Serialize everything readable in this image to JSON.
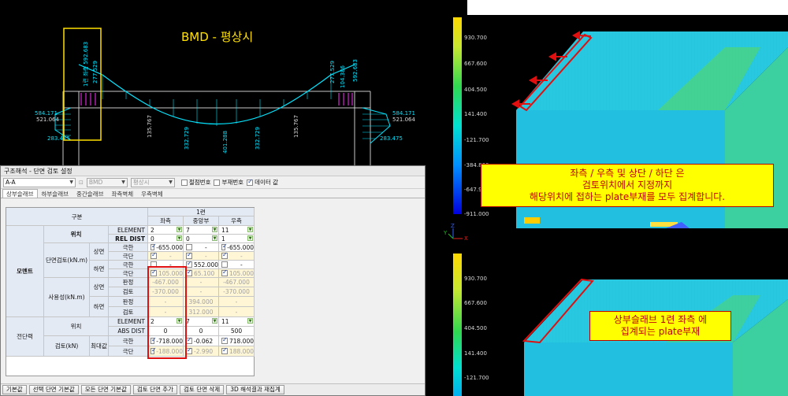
{
  "bmd": {
    "title": "BMD - 평상시",
    "labels": {
      "left_top": "1련 좌측 592.683",
      "left_top2": "277.529",
      "left_mid1": "584.171",
      "left_mid2": "521.064",
      "left_low": "283.475",
      "mid1": "135.767",
      "mid2": "332.729",
      "mid3": "401.288",
      "mid4": "332.729",
      "mid5": "135.767",
      "right_top": "277.529",
      "right_top2": "104.386",
      "right_top3": "592.683",
      "right_mid1": "584.171",
      "right_mid2": "521.064",
      "right_low": "283.475"
    }
  },
  "dialog": {
    "title": "구조해석 - 단면 검토 설정",
    "section_combo": "A-A",
    "bmd_combo": "BMD",
    "case_combo": "평상시",
    "toggles": [
      {
        "label": "절점번호",
        "checked": false
      },
      {
        "label": "부재번호",
        "checked": false
      },
      {
        "label": "데이터 값",
        "checked": true
      }
    ],
    "tabs": [
      "상부슬래브",
      "하부슬래브",
      "중간슬래브",
      "좌측벽체",
      "우측벽체"
    ],
    "grid": {
      "h_gubun": "구분",
      "h_span": "1련",
      "h_left": "좌측",
      "h_mid": "중앙부",
      "h_right": "우측",
      "g_moment": "모멘트",
      "g_shear": "전단력",
      "pos": "위치",
      "element": "ELEMENT",
      "rel_dist": "REL DIST",
      "abs_dist": "ABS DIST",
      "section_check": "단면검토(kN.m)",
      "service": "사용성(kN.m)",
      "shear_check": "검토(kN)",
      "top": "상면",
      "bottom": "하면",
      "max": "최대값",
      "ext": "극한",
      "min": "극단",
      "judge": "판정",
      "check": "검토",
      "el_left": "2",
      "el_mid": "7",
      "el_right": "11",
      "rd_left": "0",
      "rd_mid": "0",
      "rd_right": "1",
      "m_top_ext_l": "-655.000",
      "m_top_ext_m": "-",
      "m_top_ext_r": "-655.000",
      "m_top_min_l": "-",
      "m_top_min_m": "-",
      "m_top_min_r": "-",
      "m_bot_ext_l": "-",
      "m_bot_ext_m": "552.000",
      "m_bot_ext_r": "-",
      "m_bot_min_l": "105.000",
      "m_bot_min_m": "65.100",
      "m_bot_min_r": "105.000",
      "s_top_j_l": "-467.000",
      "s_top_j_m": "-",
      "s_top_j_r": "-467.000",
      "s_top_c_l": "-370.000",
      "s_top_c_m": "-",
      "s_top_c_r": "-370.000",
      "s_bot_j_l": "-",
      "s_bot_j_m": "394.000",
      "s_bot_j_r": "-",
      "s_bot_c_l": "-",
      "s_bot_c_m": "312.000",
      "s_bot_c_r": "-",
      "sh_el_l": "2",
      "sh_el_m": "7",
      "sh_el_r": "11",
      "sh_abs_l": "0",
      "sh_abs_m": "0",
      "sh_abs_r": "500",
      "sh_ext_l": "-718.000",
      "sh_ext_m": "-0.062",
      "sh_ext_r": "718.000",
      "sh_min_l": "-188.000",
      "sh_min_m": "-2.990",
      "sh_min_r": "188.000"
    },
    "buttons": [
      "기본값",
      "선택 단면 기본값",
      "모든 단면 기본값",
      "검토 단면 추가",
      "검토 단면 삭제",
      "3D 해석결과 재집계"
    ]
  },
  "views": {
    "legend_top": [
      "930.700",
      "667.600",
      "404.500",
      "141.400",
      "-121.700",
      "-384.800",
      "-647.900",
      "-911.000"
    ],
    "legend_bottom": [
      "930.700",
      "667.600",
      "404.500",
      "141.400",
      "-121.700"
    ],
    "axis_z": "Z",
    "axis_y": "Y",
    "axis_x": "X",
    "callout1": [
      "좌측 / 우측 및 상단 / 하단 은",
      "검토위치에서 지정까지",
      "해당위치에 접하는 plate부재를 모두 집계합니다."
    ],
    "callout2": [
      "상부슬래브 1련 좌측 에",
      "집계되는 plate부재"
    ]
  }
}
